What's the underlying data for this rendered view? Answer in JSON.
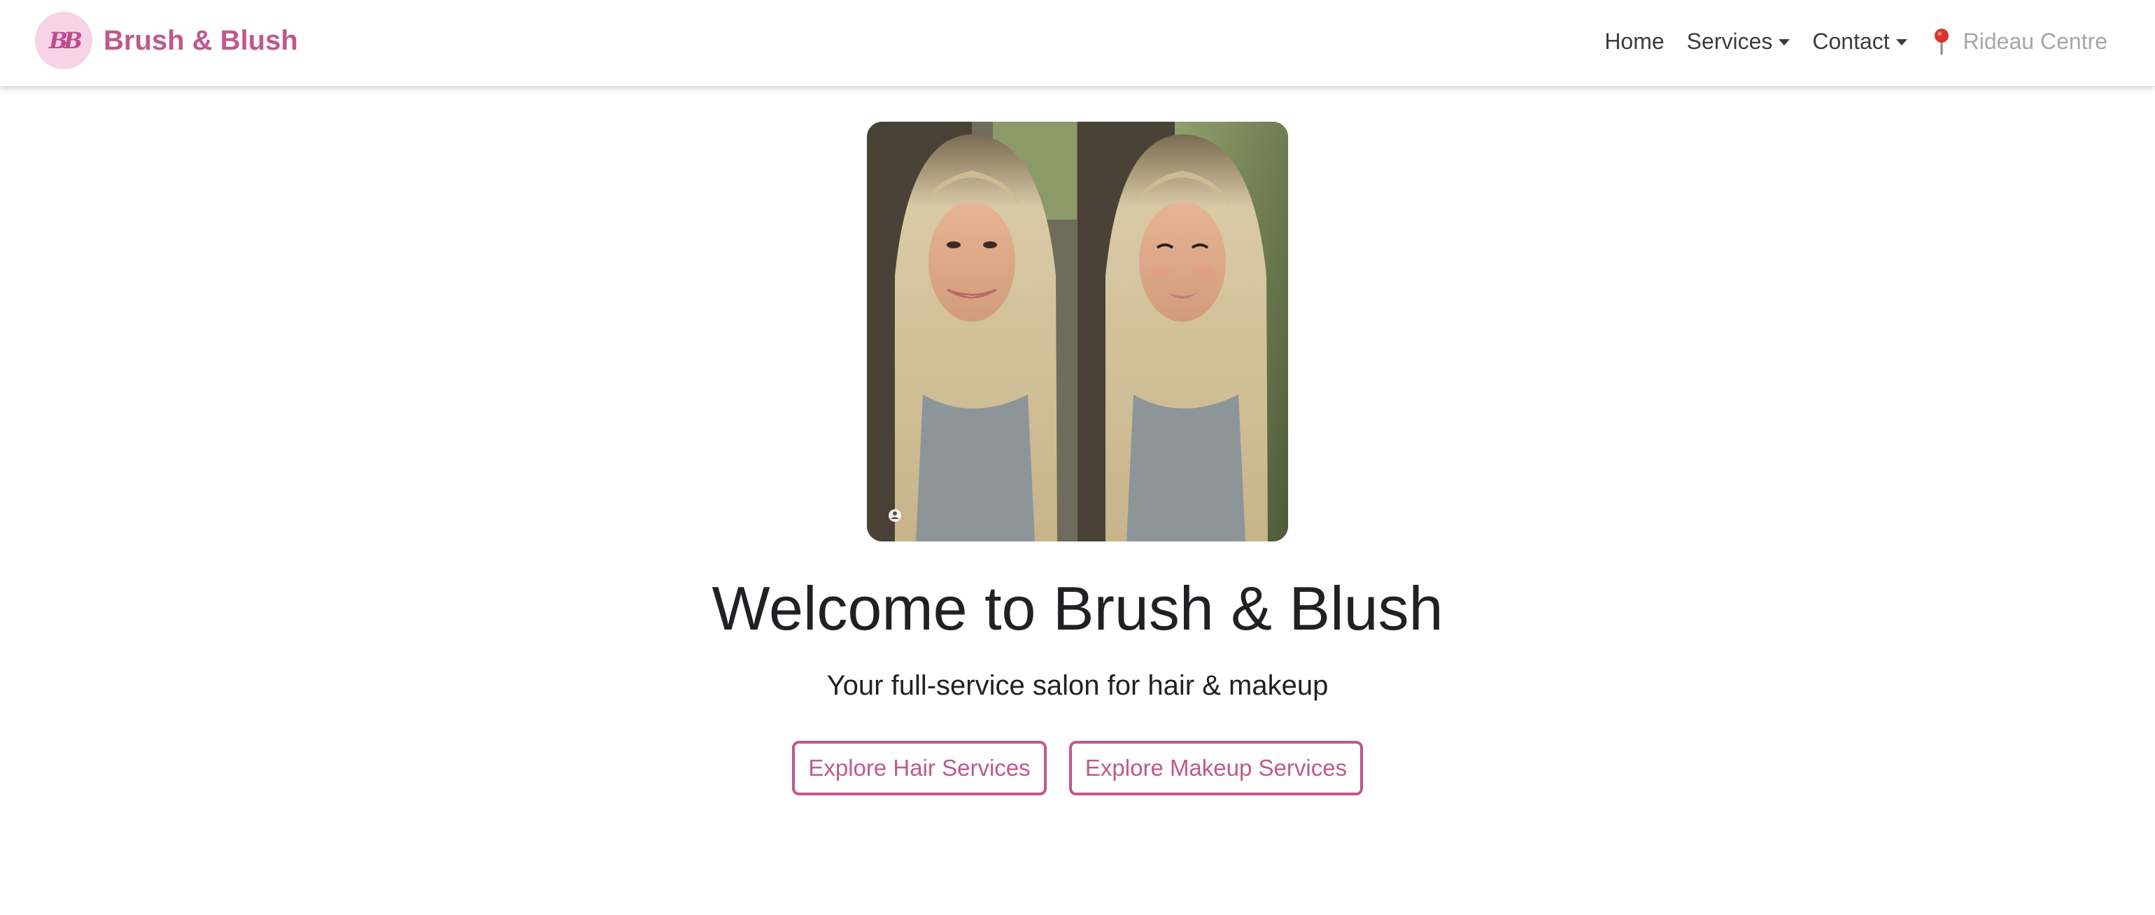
{
  "brand": {
    "name": "Brush & Blush",
    "logo_monogram": "BB",
    "logo_bg_color": "#f6d3e6",
    "accent_color": "#c0588f"
  },
  "nav": {
    "items": [
      {
        "label": "Home",
        "has_dropdown": false
      },
      {
        "label": "Services",
        "has_dropdown": true
      },
      {
        "label": "Contact",
        "has_dropdown": true
      }
    ],
    "location": {
      "icon": "map-pin-icon",
      "label": "Rideau Centre"
    }
  },
  "hero": {
    "image_alt": "before-and-after hair and makeup photo",
    "title": "Welcome to Brush & Blush",
    "subtitle": "Your full-service salon for hair & makeup",
    "buttons": [
      {
        "label": "Explore Hair Services"
      },
      {
        "label": "Explore Makeup Services"
      }
    ]
  }
}
